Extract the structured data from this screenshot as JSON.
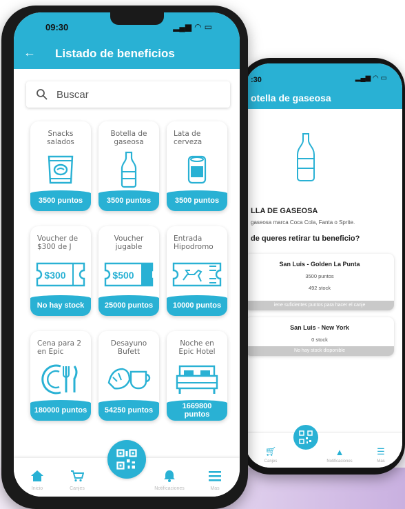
{
  "colors": {
    "accent": "#29b1d4",
    "disabled": "#c9c9c9",
    "background_tint": "#d8c6e8"
  },
  "front": {
    "status": {
      "time": "09:30"
    },
    "header": {
      "title": "Listado de beneficios"
    },
    "search": {
      "placeholder": "Buscar"
    },
    "items": [
      {
        "name": "Snacks\nsalados",
        "price": "3500 puntos",
        "icon": "snack-bag-icon"
      },
      {
        "name": "Botella de\ngaseosa",
        "price": "3500 puntos",
        "icon": "bottle-icon"
      },
      {
        "name": "Lata de\ncerveza",
        "price": "3500 puntos",
        "icon": "can-icon"
      },
      {
        "name": "Voucher de\n$300 de J",
        "price": "No hay stock",
        "icon": "voucher-300-icon",
        "voucher": "$300"
      },
      {
        "name": "Voucher\njugable",
        "price": "25000 puntos",
        "icon": "voucher-500-icon",
        "voucher": "$500"
      },
      {
        "name": "Entrada\nHipodromo",
        "price": "10000 puntos",
        "icon": "horse-ticket-icon"
      },
      {
        "name": "Cena para 2\nen Epic",
        "price": "180000 puntos",
        "icon": "dinner-icon"
      },
      {
        "name": "Desayuno\nBufett",
        "price": "54250 puntos",
        "icon": "breakfast-icon"
      },
      {
        "name": "Noche en\nEpic Hotel",
        "price": "1669800\npuntos",
        "icon": "bed-icon"
      }
    ],
    "tabbar": {
      "inicio": "Inicio",
      "canjes": "Canjes",
      "notificaciones": "Notificaciones",
      "mas": "Mas"
    }
  },
  "back": {
    "status": {
      "time": ":30"
    },
    "header": {
      "title": "otella de gaseosa"
    },
    "product": {
      "title": "LLA DE GASEOSA",
      "description": "gaseosa marca Coca Cola, Fanta o Sprite.",
      "question": "de queres retirar tu beneficio?"
    },
    "stores": [
      {
        "name": "San Luis - Golden La Punta",
        "points": "3500 puntos",
        "stock": "492 stock",
        "footer": "iene suficientes puntos para hacer el canje"
      },
      {
        "name": "San Luis - New York",
        "stock": "0 stock",
        "footer": "No hay stock disponible"
      }
    ],
    "tabbar": {
      "canjes": "Canjes",
      "notificaciones": "Notificaciones",
      "mas": "Mas"
    }
  }
}
